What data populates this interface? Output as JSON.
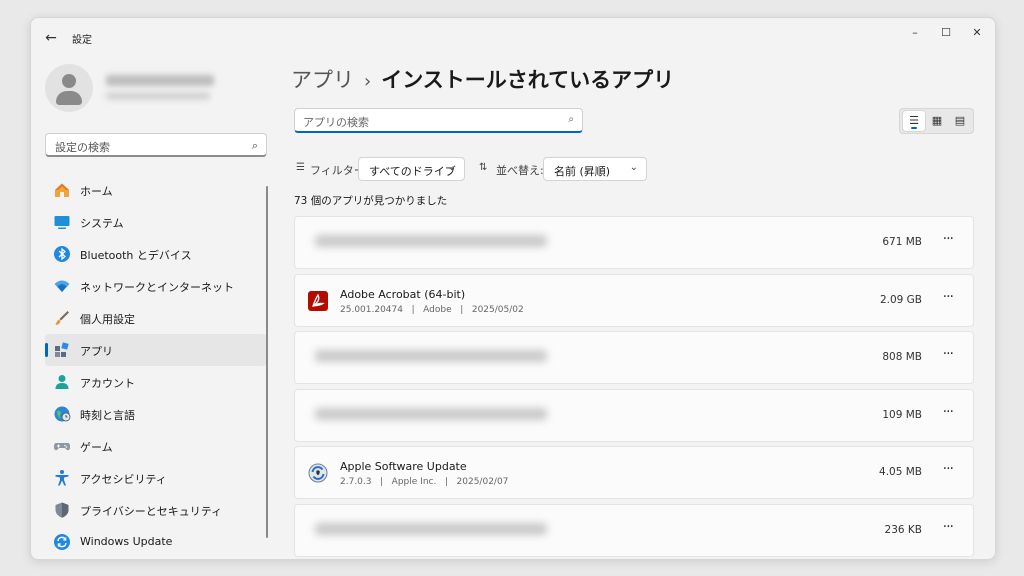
{
  "window": {
    "title": "設定",
    "controls": {
      "minimize": "–",
      "maximize": "☐",
      "close": "✕"
    }
  },
  "sidebar": {
    "search_placeholder": "設定の検索",
    "items": [
      {
        "label": "ホーム",
        "icon": "home-icon",
        "active": false
      },
      {
        "label": "システム",
        "icon": "system-icon",
        "active": false
      },
      {
        "label": "Bluetooth とデバイス",
        "icon": "bluetooth-icon",
        "active": false
      },
      {
        "label": "ネットワークとインターネット",
        "icon": "wifi-icon",
        "active": false
      },
      {
        "label": "個人用設定",
        "icon": "brush-icon",
        "active": false
      },
      {
        "label": "アプリ",
        "icon": "apps-icon",
        "active": true
      },
      {
        "label": "アカウント",
        "icon": "account-icon",
        "active": false
      },
      {
        "label": "時刻と言語",
        "icon": "globe-icon",
        "active": false
      },
      {
        "label": "ゲーム",
        "icon": "gamepad-icon",
        "active": false
      },
      {
        "label": "アクセシビリティ",
        "icon": "accessibility-icon",
        "active": false
      },
      {
        "label": "プライバシーとセキュリティ",
        "icon": "shield-icon",
        "active": false
      },
      {
        "label": "Windows Update",
        "icon": "update-icon",
        "active": false
      }
    ]
  },
  "main": {
    "breadcrumb": {
      "parent": "アプリ",
      "separator": "›",
      "current": "インストールされているアプリ"
    },
    "search_placeholder": "アプリの検索",
    "filter": {
      "label": "フィルター:",
      "value": "すべてのドライブ"
    },
    "sort": {
      "label": "並べ替え:",
      "value": "名前 (昇順)"
    },
    "count_text": "73 個のアプリが見つかりました",
    "apps": [
      {
        "blurred": true,
        "name": "",
        "meta": "",
        "size": "671 MB"
      },
      {
        "blurred": false,
        "name": "Adobe Acrobat (64-bit)",
        "meta": "25.001.20474   |   Adobe   |   2025/05/02",
        "size": "2.09 GB",
        "icon": "adobe-acrobat-icon"
      },
      {
        "blurred": true,
        "name": "",
        "meta": "",
        "size": "808 MB"
      },
      {
        "blurred": true,
        "name": "",
        "meta": "",
        "size": "109 MB"
      },
      {
        "blurred": false,
        "name": "Apple Software Update",
        "meta": "2.7.0.3   |   Apple Inc.   |   2025/02/07",
        "size": "4.05 MB",
        "icon": "apple-software-update-icon"
      },
      {
        "blurred": true,
        "name": "",
        "meta": "",
        "size": "236 KB"
      }
    ],
    "more_label": "···"
  },
  "colors": {
    "accent": "#0067c0",
    "adobe_red": "#b30b00"
  }
}
